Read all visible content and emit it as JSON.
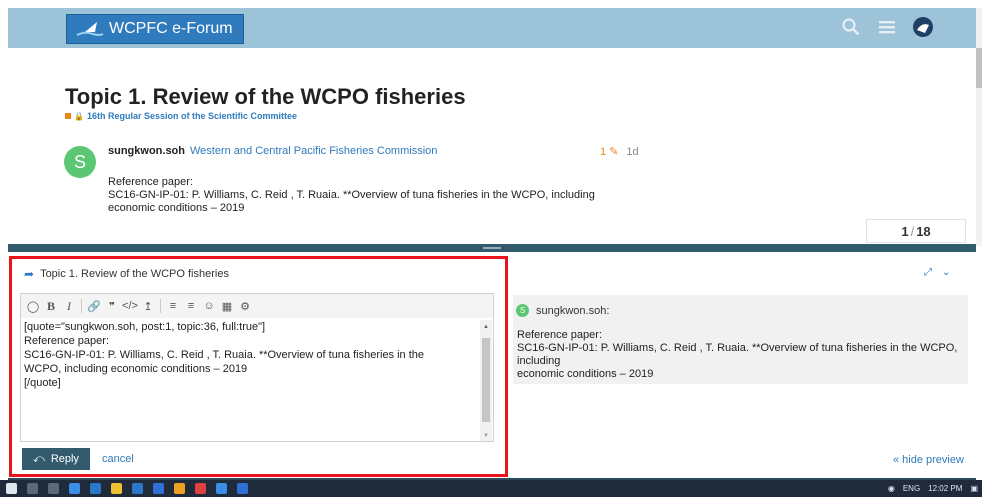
{
  "site": {
    "title": "WCPFC e-Forum"
  },
  "topic": {
    "title": "Topic 1. Review of the WCPO fisheries",
    "category": "16th Regular Session of the Scientific Committee"
  },
  "post": {
    "avatar_letter": "S",
    "username": "sungkwon.soh",
    "organization": "Western and Central Pacific Fisheries Commission",
    "edits": "1",
    "age": "1d",
    "body_line1": "Reference paper:",
    "body_line2": "SC16-GN-IP-01: P. Williams, C. Reid , T. Ruaia. **Overview of tuna fisheries in the WCPO, including",
    "body_line3": "economic conditions – 2019"
  },
  "progress": {
    "current": "1",
    "total": "18"
  },
  "composer": {
    "reply_to": "Topic 1. Review of the WCPO fisheries",
    "editor_text": "[quote=\"sungkwon.soh, post:1, topic:36, full:true\"]\nReference paper:\nSC16-GN-IP-01: P. Williams, C. Reid , T. Ruaia. **Overview of tuna fisheries in the\nWCPO, including economic conditions – 2019\n[/quote]",
    "reply_label": "Reply",
    "cancel_label": "cancel",
    "hide_preview_label": "« hide preview"
  },
  "preview": {
    "avatar_letter": "S",
    "username": "sungkwon.soh:",
    "line1": "Reference paper:",
    "line2": "SC16-GN-IP-01: P. Williams, C. Reid , T. Ruaia. **Overview of tuna fisheries in the WCPO, including",
    "line3": "economic conditions – 2019"
  },
  "taskbar": {
    "lang": "ENG",
    "time": "12:02 PM"
  },
  "colors": {
    "header": "#9cc3d8",
    "brand": "#2f7bbd",
    "accent": "#e8871a",
    "composer_bar": "#335b6e",
    "highlight": "#e8141c"
  }
}
